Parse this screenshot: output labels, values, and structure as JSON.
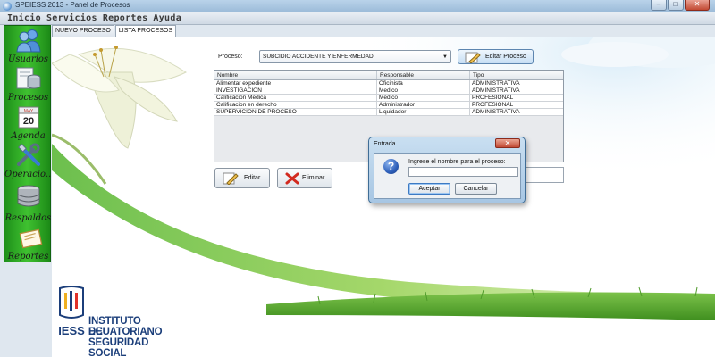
{
  "window": {
    "title": "SPEIESS 2013 - Panel de Procesos",
    "controls": [
      "minimize",
      "maximize",
      "close"
    ]
  },
  "menubar": [
    "Inicio",
    "Servicios",
    "Reportes",
    "Ayuda"
  ],
  "sidebar": {
    "items": [
      {
        "label": "Usuarios",
        "icon": "users-icon"
      },
      {
        "label": "Procesos",
        "icon": "database-icon"
      },
      {
        "label": "Agenda",
        "icon": "calendar-icon"
      },
      {
        "label": "Operacio...",
        "icon": "tools-icon"
      },
      {
        "label": "Respaldos",
        "icon": "backup-disk-icon"
      },
      {
        "label": "Reportes",
        "icon": "report-icon"
      }
    ],
    "calendar_month": "MAY",
    "calendar_day": "20"
  },
  "tabs": [
    {
      "label": "NUEVO PROCESO",
      "active": false
    },
    {
      "label": "LISTA PROCESOS",
      "active": true
    }
  ],
  "process_selector": {
    "label": "Proceso:",
    "selected": "SUBCIDIO ACCIDENTE Y ENFERMEDAD",
    "button_label": "Editar Proceso"
  },
  "table": {
    "columns": [
      "Nombre",
      "Responsable",
      "Tipo"
    ],
    "rows": [
      [
        "Alimentar expediente",
        "Oficinista",
        "ADMINISTRATIVA"
      ],
      [
        "INVESTIGACION",
        "Medico",
        "ADMINISTRATIVA"
      ],
      [
        "Calificacion Medica",
        "Medico",
        "PROFESIONAL"
      ],
      [
        "Calificacion en derecho",
        "Administrador",
        "PROFESIONAL"
      ],
      [
        "SUPERVICION DE PROCESO",
        "Liquidador",
        "ADMINISTRATIVA"
      ]
    ]
  },
  "actions": {
    "edit_label": "Editar",
    "delete_label": "Eliminar"
  },
  "logo": {
    "line1": "INSTITUTO ECUATORIANO",
    "line2": "DE SEGURIDAD SOCIAL",
    "acronym": "IESS"
  },
  "dialog": {
    "title": "Entrada",
    "prompt": "Ingrese el nombre para el proceso:",
    "input_value": "",
    "ok_label": "Aceptar",
    "cancel_label": "Cancelar"
  },
  "colors": {
    "sidebar_green": "#3fc130",
    "dialog_frame": "#a7c6e3",
    "logo_blue": "#1b3e7a"
  }
}
